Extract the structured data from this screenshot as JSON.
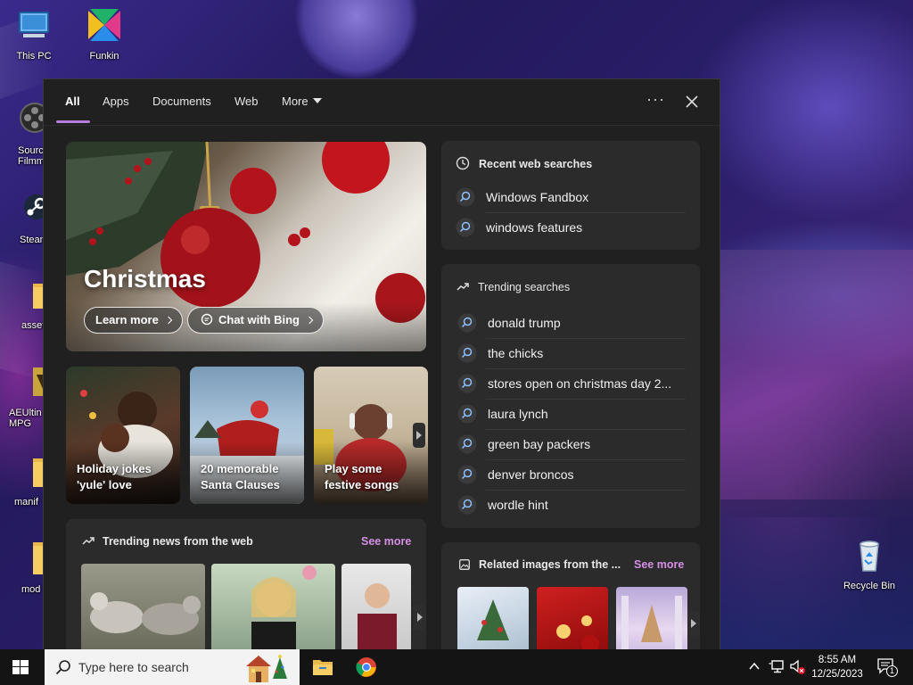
{
  "desktop": {
    "icons": [
      {
        "label": "This PC",
        "icon": "computer-icon"
      },
      {
        "label": "Funkin",
        "icon": "funkin-app-icon"
      },
      {
        "label": "Sourc\nFilmma",
        "icon": "film-reel-icon"
      },
      {
        "label": "Stean",
        "icon": "steam-icon"
      },
      {
        "label": "asset",
        "icon": "folder-icon"
      },
      {
        "label": "AEUltin\nMPG",
        "icon": "file-icon"
      },
      {
        "label": "manif",
        "icon": "folder-icon"
      },
      {
        "label": "mod",
        "icon": "folder-icon"
      },
      {
        "label": "Recycle Bin",
        "icon": "recycle-bin-icon"
      }
    ]
  },
  "search_panel": {
    "tabs": [
      "All",
      "Apps",
      "Documents",
      "Web",
      "More"
    ],
    "active_tab": "All",
    "more_icon": "ellipsis-icon",
    "close_icon": "close-icon",
    "hero": {
      "title": "Christmas",
      "learn_more": "Learn more",
      "chat_with_bing": "Chat with Bing"
    },
    "cards": [
      {
        "caption": "Holiday jokes 'yule' love"
      },
      {
        "caption": "20 memorable Santa Clauses"
      },
      {
        "caption": "Play some festive songs"
      }
    ],
    "trending_news": {
      "title": "Trending news from the web",
      "see_more": "See more"
    },
    "recent_web_searches": {
      "title": "Recent web searches",
      "items": [
        "Windows Fandbox",
        "windows features"
      ]
    },
    "trending_searches": {
      "title": "Trending searches",
      "items": [
        "donald trump",
        "the chicks",
        "stores open on christmas day 2...",
        "laura lynch",
        "green bay packers",
        "denver broncos",
        "wordle hint"
      ]
    },
    "related_images": {
      "title": "Related images from the ...",
      "see_more": "See more"
    }
  },
  "taskbar": {
    "search_placeholder": "Type here to search",
    "time": "8:55 AM",
    "date": "12/25/2023",
    "notification_count": "1"
  }
}
